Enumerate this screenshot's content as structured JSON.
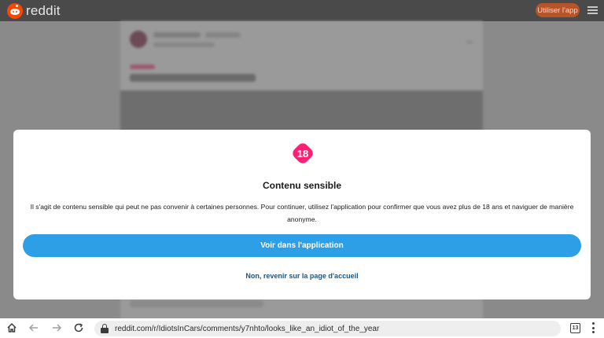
{
  "header": {
    "brand": "reddit",
    "use_app_label": "Utiliser l'app",
    "menu_icon": "hamburger-menu-icon",
    "brand_color": "#ff4500"
  },
  "modal": {
    "badge_text": "18",
    "badge_color": "#ff1f73",
    "title": "Contenu sensible",
    "description": "Il s'agit de contenu sensible qui peut ne pas convenir à certaines personnes. Pour continuer, utilisez l'application pour confirmer que vous avez plus de 18 ans et naviguer de manière anonyme.",
    "primary_button": "Voir dans l'application",
    "primary_color": "#2c9fe6",
    "secondary_link": "Non, revenir sur la page d'accueil"
  },
  "browser": {
    "url": "reddit.com/r/IdiotsInCars/comments/y7nhto/looks_like_an_idiot_of_the_year",
    "tab_count": "13",
    "icons": [
      "home-icon",
      "back-arrow-icon",
      "forward-arrow-icon",
      "reload-icon",
      "lock-icon",
      "tabs-icon",
      "more-vert-icon"
    ]
  }
}
